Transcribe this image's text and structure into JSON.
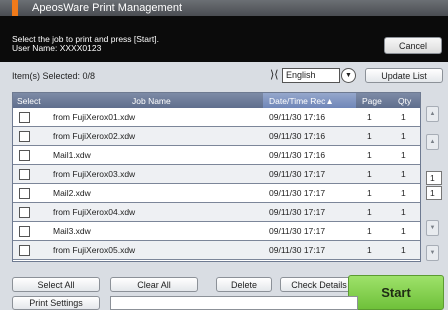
{
  "app": {
    "title": "ApeosWare Print Management"
  },
  "info": {
    "instruction": "Select the job to print and press [Start].",
    "user": "User Name: XXXX0123"
  },
  "buttons": {
    "cancel": "Cancel",
    "update_list": "Update List",
    "select_all": "Select All",
    "clear_all": "Clear All",
    "delete": "Delete",
    "check_details": "Check Details",
    "start": "Start",
    "print_settings": "Print Settings"
  },
  "selection": {
    "summary": "Item(s) Selected: 0/8"
  },
  "language": {
    "selected": "English"
  },
  "table": {
    "headers": {
      "select": "Select",
      "job_name": "Job Name",
      "date_time": "Date/Time Rec▲",
      "page": "Page",
      "qty": "Qty"
    },
    "rows": [
      {
        "name": "from FujiXerox01.xdw",
        "date": "09/11/30 17:16",
        "page": "1",
        "qty": "1"
      },
      {
        "name": "from FujiXerox02.xdw",
        "date": "09/11/30 17:16",
        "page": "1",
        "qty": "1"
      },
      {
        "name": "Mail1.xdw",
        "date": "09/11/30 17:16",
        "page": "1",
        "qty": "1"
      },
      {
        "name": "from FujiXerox03.xdw",
        "date": "09/11/30 17:17",
        "page": "1",
        "qty": "1"
      },
      {
        "name": "Mail2.xdw",
        "date": "09/11/30 17:17",
        "page": "1",
        "qty": "1"
      },
      {
        "name": "from FujiXerox04.xdw",
        "date": "09/11/30 17:17",
        "page": "1",
        "qty": "1"
      },
      {
        "name": "Mail3.xdw",
        "date": "09/11/30 17:17",
        "page": "1",
        "qty": "1"
      },
      {
        "name": "from FujiXerox05.xdw",
        "date": "09/11/30 17:17",
        "page": "1",
        "qty": "1"
      }
    ]
  },
  "pager": {
    "current": "1",
    "total": "1"
  },
  "icons": {
    "language": "language-icon",
    "scroll_top": "scroll-top-icon",
    "scroll_up": "scroll-up-icon",
    "scroll_down": "scroll-down-icon",
    "scroll_bottom": "scroll-bottom-icon"
  },
  "colors": {
    "accent": "#f07a1a",
    "start_green": "#7fd04b",
    "header_blue": "#6f86b8"
  }
}
